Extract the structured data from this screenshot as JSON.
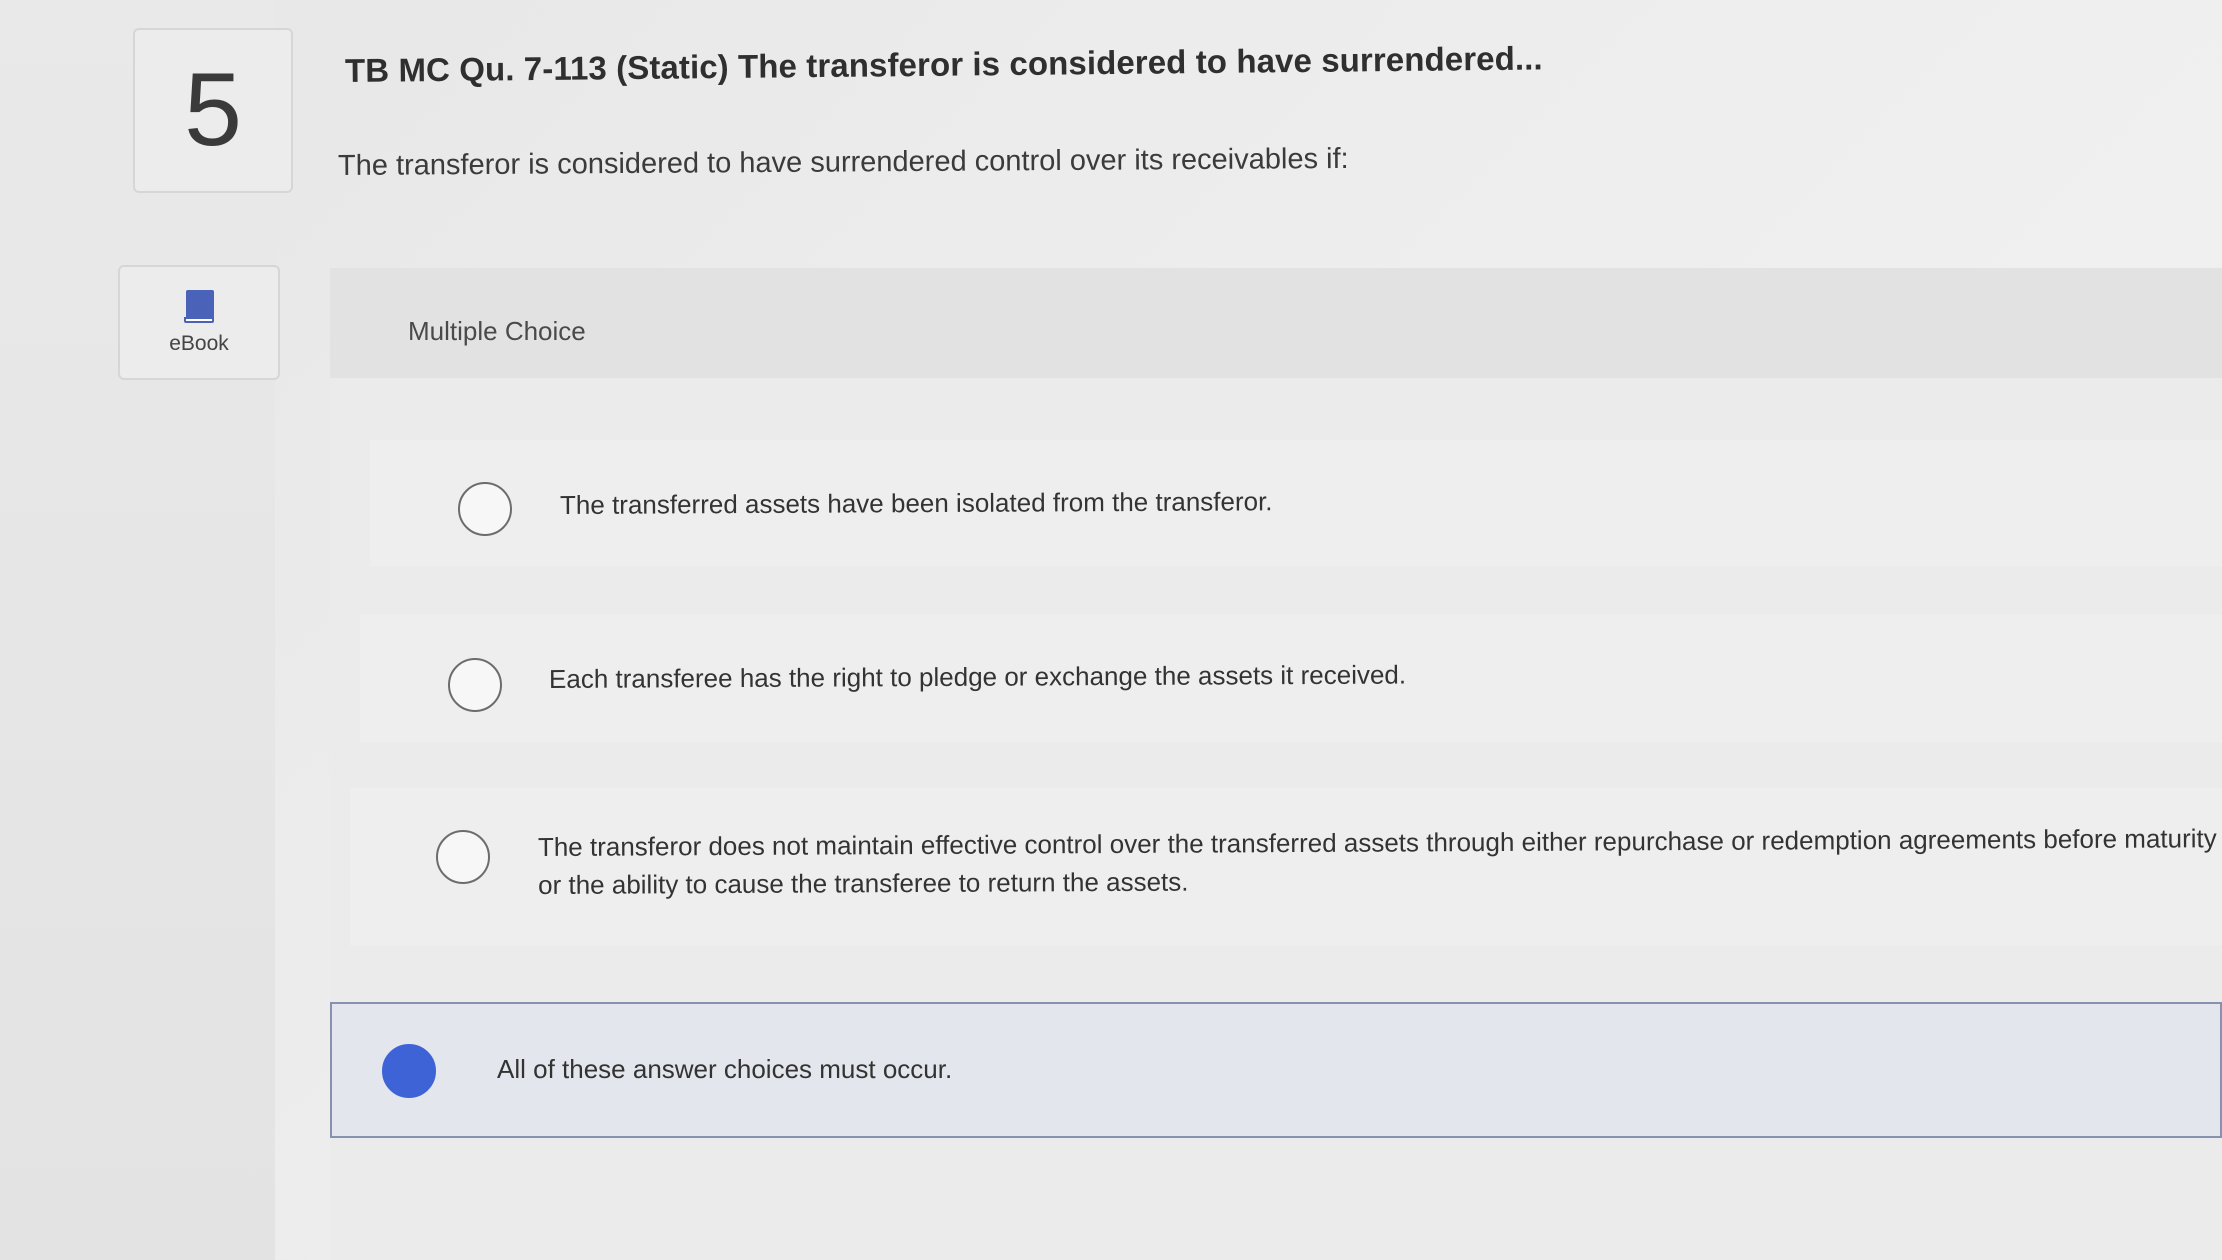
{
  "question": {
    "number": "5",
    "title": "TB MC Qu. 7-113 (Static) The transferor is considered to have surrendered...",
    "prompt": "The transferor is considered to have surrendered control over its receivables if:"
  },
  "ebook": {
    "label": "eBook",
    "icon": "book-icon"
  },
  "answer_section": {
    "label": "Multiple Choice",
    "options": [
      {
        "text": "The transferred assets have been isolated from the transferor.",
        "selected": false
      },
      {
        "text": "Each transferee has the right to pledge or exchange the assets it received.",
        "selected": false
      },
      {
        "text": "The transferor does not maintain effective control over the transferred assets through either repurchase or redemption agreements before maturity or the ability to cause the transferee to return the assets.",
        "selected": false
      },
      {
        "text": "All of these answer choices must occur.",
        "selected": true
      }
    ]
  },
  "colors": {
    "selected_radio": "#3e63d6",
    "selected_option_border": "#8792b1"
  }
}
